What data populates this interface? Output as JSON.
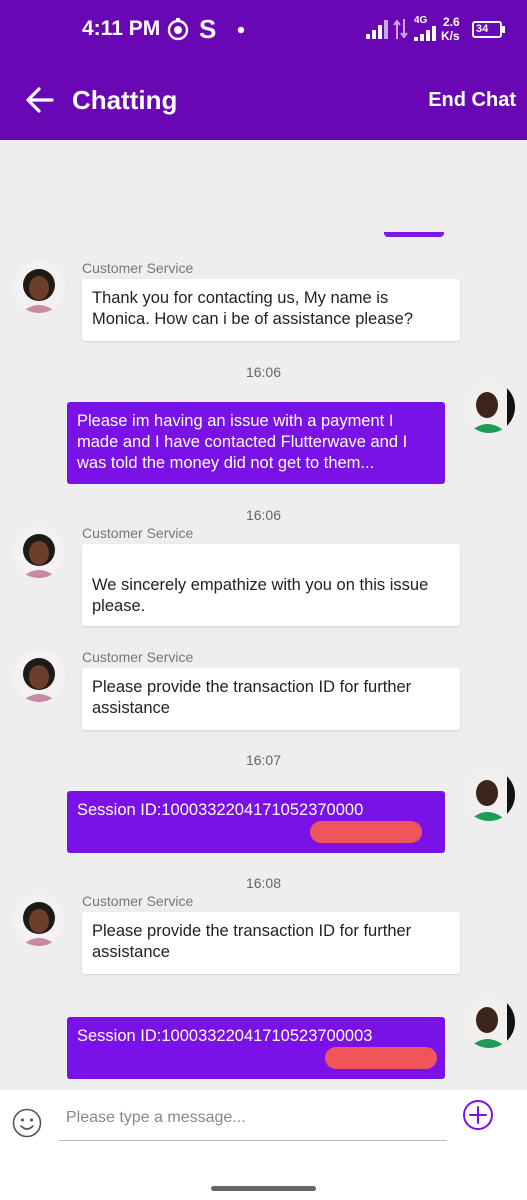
{
  "status_bar": {
    "time": "4:11 PM",
    "network": "4G",
    "speed_value": "2.6",
    "speed_unit": "K/s",
    "battery": "34"
  },
  "header": {
    "title": "Chatting",
    "end_chat": "End Chat"
  },
  "messages": [
    {
      "type": "in",
      "sender": "Customer Service",
      "text": "Thank you for contacting us, My name is Monica. How can i be of assistance please?"
    },
    {
      "type": "time",
      "text": "16:06"
    },
    {
      "type": "out",
      "text": "Please im having an issue with a payment I made and I have contacted Flutterwave and I was told the money did not get to them..."
    },
    {
      "type": "time",
      "text": "16:06"
    },
    {
      "type": "in",
      "sender": "Customer Service",
      "text": "We sincerely empathize with you on this issue please."
    },
    {
      "type": "in",
      "sender": "Customer Service",
      "text": "Please provide the transaction ID for further assistance"
    },
    {
      "type": "time",
      "text": "16:07"
    },
    {
      "type": "out",
      "text": "Session ID:1000332204171052370000"
    },
    {
      "type": "time",
      "text": "16:08"
    },
    {
      "type": "in",
      "sender": "Customer Service",
      "text": "Please provide the transaction ID for further assistance"
    },
    {
      "type": "out",
      "text": "Session ID:10003322041710523700003"
    }
  ],
  "input": {
    "placeholder": "Please type a message..."
  },
  "colors": {
    "brand": "#6a07b4",
    "outgoing_bubble": "#7a12e8",
    "redaction": "#f0555c"
  }
}
